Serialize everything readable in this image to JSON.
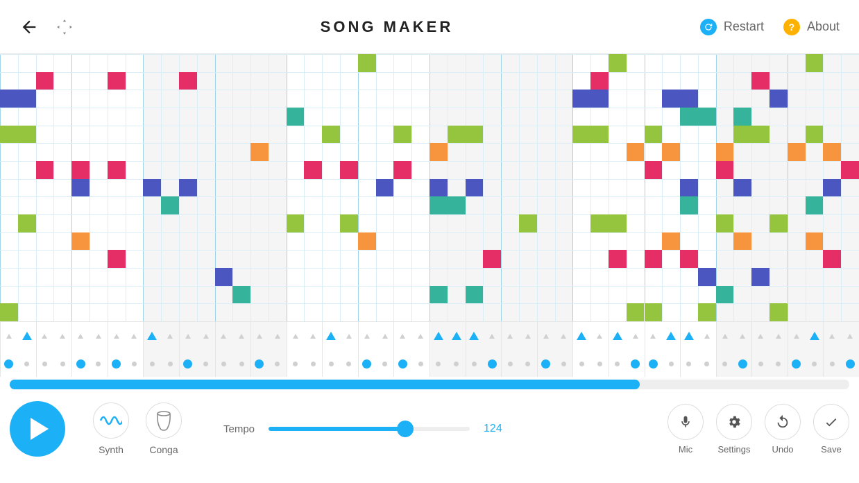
{
  "header": {
    "title": "SONG MAKER",
    "restart_label": "Restart",
    "about_label": "About"
  },
  "grid": {
    "rows": 14,
    "cols": 48,
    "majorEvery": 4,
    "shadeGroups": [
      0,
      1,
      0,
      1,
      0,
      1
    ],
    "colors": {
      "red": "#e52e66",
      "orange": "#f7943e",
      "green": "#95c53f",
      "teal": "#35b39b",
      "blue": "#4b56c0"
    },
    "notes": [
      {
        "r": 0,
        "c": 20,
        "k": "green"
      },
      {
        "r": 0,
        "c": 34,
        "k": "green"
      },
      {
        "r": 0,
        "c": 45,
        "k": "green"
      },
      {
        "r": 1,
        "c": 2,
        "k": "red"
      },
      {
        "r": 1,
        "c": 6,
        "k": "red"
      },
      {
        "r": 1,
        "c": 10,
        "k": "red"
      },
      {
        "r": 1,
        "c": 33,
        "k": "red"
      },
      {
        "r": 1,
        "c": 42,
        "k": "red"
      },
      {
        "r": 2,
        "c": 0,
        "k": "blue"
      },
      {
        "r": 2,
        "c": 1,
        "k": "blue"
      },
      {
        "r": 2,
        "c": 32,
        "k": "blue"
      },
      {
        "r": 2,
        "c": 33,
        "k": "blue"
      },
      {
        "r": 2,
        "c": 37,
        "k": "blue"
      },
      {
        "r": 2,
        "c": 38,
        "k": "blue"
      },
      {
        "r": 2,
        "c": 43,
        "k": "blue"
      },
      {
        "r": 3,
        "c": 16,
        "k": "teal"
      },
      {
        "r": 3,
        "c": 38,
        "k": "teal"
      },
      {
        "r": 3,
        "c": 39,
        "k": "teal"
      },
      {
        "r": 3,
        "c": 41,
        "k": "teal"
      },
      {
        "r": 4,
        "c": 0,
        "k": "green"
      },
      {
        "r": 4,
        "c": 1,
        "k": "green"
      },
      {
        "r": 4,
        "c": 18,
        "k": "green"
      },
      {
        "r": 4,
        "c": 22,
        "k": "green"
      },
      {
        "r": 4,
        "c": 25,
        "k": "green"
      },
      {
        "r": 4,
        "c": 26,
        "k": "green"
      },
      {
        "r": 4,
        "c": 32,
        "k": "green"
      },
      {
        "r": 4,
        "c": 33,
        "k": "green"
      },
      {
        "r": 4,
        "c": 36,
        "k": "green"
      },
      {
        "r": 4,
        "c": 41,
        "k": "green"
      },
      {
        "r": 4,
        "c": 42,
        "k": "green"
      },
      {
        "r": 4,
        "c": 45,
        "k": "green"
      },
      {
        "r": 5,
        "c": 14,
        "k": "orange"
      },
      {
        "r": 5,
        "c": 24,
        "k": "orange"
      },
      {
        "r": 5,
        "c": 35,
        "k": "orange"
      },
      {
        "r": 5,
        "c": 37,
        "k": "orange"
      },
      {
        "r": 5,
        "c": 40,
        "k": "orange"
      },
      {
        "r": 5,
        "c": 44,
        "k": "orange"
      },
      {
        "r": 5,
        "c": 46,
        "k": "orange"
      },
      {
        "r": 6,
        "c": 2,
        "k": "red"
      },
      {
        "r": 6,
        "c": 4,
        "k": "red"
      },
      {
        "r": 6,
        "c": 6,
        "k": "red"
      },
      {
        "r": 6,
        "c": 17,
        "k": "red"
      },
      {
        "r": 6,
        "c": 19,
        "k": "red"
      },
      {
        "r": 6,
        "c": 22,
        "k": "red"
      },
      {
        "r": 6,
        "c": 36,
        "k": "red"
      },
      {
        "r": 6,
        "c": 40,
        "k": "red"
      },
      {
        "r": 6,
        "c": 47,
        "k": "red"
      },
      {
        "r": 7,
        "c": 4,
        "k": "blue"
      },
      {
        "r": 7,
        "c": 8,
        "k": "blue"
      },
      {
        "r": 7,
        "c": 10,
        "k": "blue"
      },
      {
        "r": 7,
        "c": 21,
        "k": "blue"
      },
      {
        "r": 7,
        "c": 24,
        "k": "blue"
      },
      {
        "r": 7,
        "c": 26,
        "k": "blue"
      },
      {
        "r": 7,
        "c": 38,
        "k": "blue"
      },
      {
        "r": 7,
        "c": 41,
        "k": "blue"
      },
      {
        "r": 7,
        "c": 46,
        "k": "blue"
      },
      {
        "r": 8,
        "c": 9,
        "k": "teal"
      },
      {
        "r": 8,
        "c": 24,
        "k": "teal"
      },
      {
        "r": 8,
        "c": 25,
        "k": "teal"
      },
      {
        "r": 8,
        "c": 38,
        "k": "teal"
      },
      {
        "r": 8,
        "c": 45,
        "k": "teal"
      },
      {
        "r": 9,
        "c": 1,
        "k": "green"
      },
      {
        "r": 9,
        "c": 16,
        "k": "green"
      },
      {
        "r": 9,
        "c": 19,
        "k": "green"
      },
      {
        "r": 9,
        "c": 29,
        "k": "green"
      },
      {
        "r": 9,
        "c": 33,
        "k": "green"
      },
      {
        "r": 9,
        "c": 34,
        "k": "green"
      },
      {
        "r": 9,
        "c": 40,
        "k": "green"
      },
      {
        "r": 9,
        "c": 43,
        "k": "green"
      },
      {
        "r": 10,
        "c": 4,
        "k": "orange"
      },
      {
        "r": 10,
        "c": 20,
        "k": "orange"
      },
      {
        "r": 10,
        "c": 37,
        "k": "orange"
      },
      {
        "r": 10,
        "c": 41,
        "k": "orange"
      },
      {
        "r": 10,
        "c": 45,
        "k": "orange"
      },
      {
        "r": 11,
        "c": 6,
        "k": "red"
      },
      {
        "r": 11,
        "c": 27,
        "k": "red"
      },
      {
        "r": 11,
        "c": 34,
        "k": "red"
      },
      {
        "r": 11,
        "c": 36,
        "k": "red"
      },
      {
        "r": 11,
        "c": 38,
        "k": "red"
      },
      {
        "r": 11,
        "c": 46,
        "k": "red"
      },
      {
        "r": 12,
        "c": 12,
        "k": "blue"
      },
      {
        "r": 12,
        "c": 39,
        "k": "blue"
      },
      {
        "r": 12,
        "c": 42,
        "k": "blue"
      },
      {
        "r": 13,
        "c": 13,
        "k": "teal"
      },
      {
        "r": 13,
        "c": 24,
        "k": "teal"
      },
      {
        "r": 13,
        "c": 26,
        "k": "teal"
      },
      {
        "r": 13,
        "c": 40,
        "k": "teal"
      },
      {
        "r": 14,
        "c": 0,
        "k": "green"
      },
      {
        "r": 14,
        "c": 35,
        "k": "green"
      },
      {
        "r": 14,
        "c": 36,
        "k": "green"
      },
      {
        "r": 14,
        "c": 39,
        "k": "green"
      },
      {
        "r": 14,
        "c": 43,
        "k": "green"
      }
    ]
  },
  "percussion": {
    "cols": 48,
    "row1": [
      0,
      1,
      0,
      0,
      0,
      0,
      0,
      0,
      1,
      0,
      0,
      0,
      0,
      0,
      0,
      0,
      0,
      0,
      1,
      0,
      0,
      0,
      0,
      0,
      1,
      1,
      1,
      0,
      0,
      0,
      0,
      0,
      1,
      0,
      1,
      0,
      0,
      1,
      1,
      0,
      0,
      0,
      0,
      0,
      0,
      1,
      0,
      0
    ],
    "row2": [
      1,
      0,
      0,
      0,
      1,
      0,
      1,
      0,
      0,
      0,
      1,
      0,
      0,
      0,
      1,
      0,
      0,
      0,
      0,
      0,
      1,
      0,
      1,
      0,
      0,
      0,
      0,
      1,
      0,
      0,
      1,
      0,
      0,
      0,
      0,
      1,
      1,
      0,
      0,
      0,
      0,
      1,
      0,
      0,
      1,
      0,
      0,
      1
    ]
  },
  "progress": {
    "percent": 75
  },
  "instruments": {
    "melodic_label": "Synth",
    "percussion_label": "Conga"
  },
  "tempo": {
    "label": "Tempo",
    "value": "124",
    "percent": 68
  },
  "buttons": {
    "mic": "Mic",
    "settings": "Settings",
    "undo": "Undo",
    "save": "Save"
  }
}
